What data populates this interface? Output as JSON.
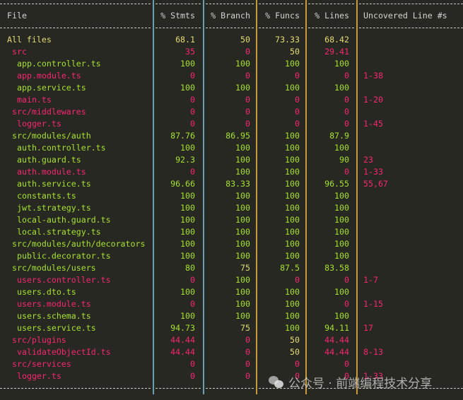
{
  "colors": {
    "background": "#272822",
    "high": "#a6e22e",
    "medium": "#e6db74",
    "low": "#f92672",
    "border_blue": "#6a9fb5",
    "border_orange": "#c99a3a",
    "header_text": "#d4d4d4"
  },
  "headers": [
    "File",
    "% Stmts",
    "% Branch",
    "% Funcs",
    "% Lines",
    "Uncovered Line #s"
  ],
  "rows": [
    {
      "file": "All files",
      "level": 0,
      "stmts": "68.1",
      "branch": "50",
      "funcs": "73.33",
      "lines": "68.42",
      "uncovered": ""
    },
    {
      "file": "src",
      "level": 1,
      "stmts": "35",
      "branch": "0",
      "funcs": "50",
      "lines": "29.41",
      "uncovered": ""
    },
    {
      "file": "app.controller.ts",
      "level": 2,
      "stmts": "100",
      "branch": "100",
      "funcs": "100",
      "lines": "100",
      "uncovered": ""
    },
    {
      "file": "app.module.ts",
      "level": 2,
      "stmts": "0",
      "branch": "0",
      "funcs": "0",
      "lines": "0",
      "uncovered": "1-38"
    },
    {
      "file": "app.service.ts",
      "level": 2,
      "stmts": "100",
      "branch": "100",
      "funcs": "100",
      "lines": "100",
      "uncovered": ""
    },
    {
      "file": "main.ts",
      "level": 2,
      "stmts": "0",
      "branch": "0",
      "funcs": "0",
      "lines": "0",
      "uncovered": "1-20"
    },
    {
      "file": "src/middlewares",
      "level": 1,
      "stmts": "0",
      "branch": "0",
      "funcs": "0",
      "lines": "0",
      "uncovered": ""
    },
    {
      "file": "logger.ts",
      "level": 2,
      "stmts": "0",
      "branch": "0",
      "funcs": "0",
      "lines": "0",
      "uncovered": "1-45"
    },
    {
      "file": "src/modules/auth",
      "level": 1,
      "stmts": "87.76",
      "branch": "86.95",
      "funcs": "100",
      "lines": "87.9",
      "uncovered": ""
    },
    {
      "file": "auth.controller.ts",
      "level": 2,
      "stmts": "100",
      "branch": "100",
      "funcs": "100",
      "lines": "100",
      "uncovered": ""
    },
    {
      "file": "auth.guard.ts",
      "level": 2,
      "stmts": "92.3",
      "branch": "100",
      "funcs": "100",
      "lines": "90",
      "uncovered": "23"
    },
    {
      "file": "auth.module.ts",
      "level": 2,
      "stmts": "0",
      "branch": "100",
      "funcs": "100",
      "lines": "0",
      "uncovered": "1-33"
    },
    {
      "file": "auth.service.ts",
      "level": 2,
      "stmts": "96.66",
      "branch": "83.33",
      "funcs": "100",
      "lines": "96.55",
      "uncovered": "55,67"
    },
    {
      "file": "constants.ts",
      "level": 2,
      "stmts": "100",
      "branch": "100",
      "funcs": "100",
      "lines": "100",
      "uncovered": ""
    },
    {
      "file": "jwt.strategy.ts",
      "level": 2,
      "stmts": "100",
      "branch": "100",
      "funcs": "100",
      "lines": "100",
      "uncovered": ""
    },
    {
      "file": "local-auth.guard.ts",
      "level": 2,
      "stmts": "100",
      "branch": "100",
      "funcs": "100",
      "lines": "100",
      "uncovered": ""
    },
    {
      "file": "local.strategy.ts",
      "level": 2,
      "stmts": "100",
      "branch": "100",
      "funcs": "100",
      "lines": "100",
      "uncovered": ""
    },
    {
      "file": "src/modules/auth/decorators",
      "level": 1,
      "stmts": "100",
      "branch": "100",
      "funcs": "100",
      "lines": "100",
      "uncovered": ""
    },
    {
      "file": "public.decorator.ts",
      "level": 2,
      "stmts": "100",
      "branch": "100",
      "funcs": "100",
      "lines": "100",
      "uncovered": ""
    },
    {
      "file": "src/modules/users",
      "level": 1,
      "stmts": "80",
      "branch": "75",
      "funcs": "87.5",
      "lines": "83.58",
      "uncovered": ""
    },
    {
      "file": "users.controller.ts",
      "level": 2,
      "stmts": "0",
      "branch": "100",
      "funcs": "0",
      "lines": "0",
      "uncovered": "1-7"
    },
    {
      "file": "users.dto.ts",
      "level": 2,
      "stmts": "100",
      "branch": "100",
      "funcs": "100",
      "lines": "100",
      "uncovered": ""
    },
    {
      "file": "users.module.ts",
      "level": 2,
      "stmts": "0",
      "branch": "100",
      "funcs": "100",
      "lines": "0",
      "uncovered": "1-15"
    },
    {
      "file": "users.schema.ts",
      "level": 2,
      "stmts": "100",
      "branch": "100",
      "funcs": "100",
      "lines": "100",
      "uncovered": ""
    },
    {
      "file": "users.service.ts",
      "level": 2,
      "stmts": "94.73",
      "branch": "75",
      "funcs": "100",
      "lines": "94.11",
      "uncovered": "17"
    },
    {
      "file": "src/plugins",
      "level": 1,
      "stmts": "44.44",
      "branch": "0",
      "funcs": "50",
      "lines": "44.44",
      "uncovered": ""
    },
    {
      "file": "validateObjectId.ts",
      "level": 2,
      "stmts": "44.44",
      "branch": "0",
      "funcs": "50",
      "lines": "44.44",
      "uncovered": "8-13"
    },
    {
      "file": "src/services",
      "level": 1,
      "stmts": "0",
      "branch": "0",
      "funcs": "0",
      "lines": "0",
      "uncovered": ""
    },
    {
      "file": "logger.ts",
      "level": 2,
      "stmts": "0",
      "branch": "0",
      "funcs": "0",
      "lines": "0",
      "uncovered": "1-33"
    }
  ],
  "watermark": "公众号 · 前端编程技术分享"
}
